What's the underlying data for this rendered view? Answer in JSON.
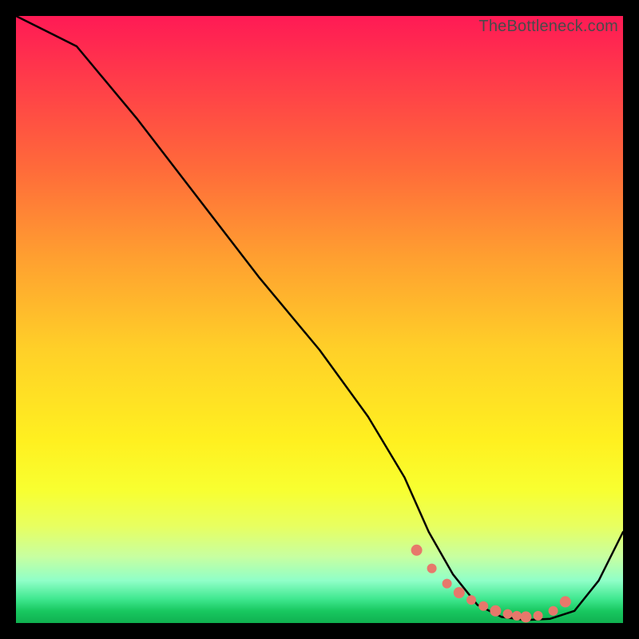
{
  "watermark": "TheBottleneck.com",
  "chart_data": {
    "type": "line",
    "title": "",
    "xlabel": "",
    "ylabel": "",
    "xlim": [
      0,
      100
    ],
    "ylim": [
      0,
      100
    ],
    "grid": false,
    "series": [
      {
        "name": "bottleneck-curve",
        "x": [
          0,
          6,
          10,
          20,
          30,
          40,
          50,
          58,
          64,
          68,
          72,
          76,
          80,
          84,
          88,
          92,
          96,
          100
        ],
        "values": [
          100,
          97,
          95,
          83,
          70,
          57,
          45,
          34,
          24,
          15,
          8,
          3,
          1,
          0.5,
          0.7,
          2,
          7,
          15
        ]
      }
    ],
    "markers": {
      "name": "highlight-dots",
      "color": "#e7786b",
      "x": [
        66,
        68.5,
        71,
        73,
        75,
        77,
        79,
        81,
        82.5,
        84,
        86,
        88.5,
        90.5
      ],
      "values": [
        12,
        9,
        6.5,
        5,
        3.8,
        2.8,
        2,
        1.5,
        1.2,
        1,
        1.2,
        2,
        3.5
      ]
    },
    "gradient_stops": [
      {
        "pos": 0,
        "color": "#ff1a55"
      },
      {
        "pos": 25,
        "color": "#ff6a3a"
      },
      {
        "pos": 55,
        "color": "#ffd028"
      },
      {
        "pos": 78,
        "color": "#f8ff30"
      },
      {
        "pos": 93,
        "color": "#90ffc8"
      },
      {
        "pos": 100,
        "color": "#10b050"
      }
    ]
  }
}
